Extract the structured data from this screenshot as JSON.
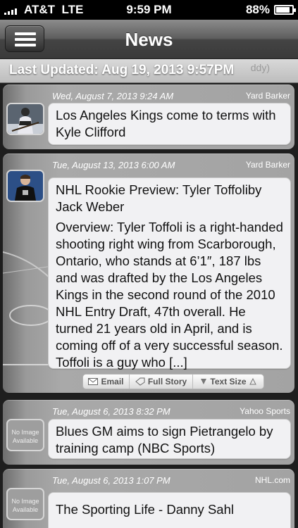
{
  "status_bar": {
    "carrier": "AT&T",
    "network": "LTE",
    "time": "9:59 PM",
    "battery": "88%",
    "battery_level": 0.88
  },
  "nav": {
    "title": "News",
    "menu_icon": "hamburger-icon"
  },
  "updated": {
    "label": "Last Updated: Aug 19, 2013 9:57PM",
    "ghost_text": "ddy)"
  },
  "articles": [
    {
      "date": "Wed, August 7, 2013 9:24 AM",
      "source": "Yard Barker",
      "title": "Los Angeles Kings come to terms with Kyle Clifford",
      "thumb": "player-photo"
    },
    {
      "date": "Tue, August 13, 2013 6:00 AM",
      "source": "Yard Barker",
      "title": "NHL Rookie Preview: Tyler Toffoliby Jack Weber",
      "summary": "Overview: Tyler Toffoli is a right-handed shooting right wing from Scarborough, Ontario, who stands at 6’1″, 187 lbs and was drafted by the Los Angeles Kings in the second round of the 2010 NHL Entry Draft, 47th overall. He turned 21 years old in April, and is coming off of a very successful season. Toffoli is a guy who [...]",
      "thumb": "player-photo",
      "actions": {
        "email": "Email",
        "full_story": "Full Story",
        "text_size": "Text Size"
      }
    },
    {
      "date": "Tue, August 6, 2013 8:32 PM",
      "source": "Yahoo Sports",
      "title": "Blues GM aims to sign Pietrangelo by training camp (NBC Sports)",
      "thumb_text": "No Image Available"
    },
    {
      "date": "Tue, August 6, 2013 1:07 PM",
      "source": "NHL.com",
      "title": "The Sporting Life - Danny Sahl",
      "thumb_text": "No Image Available"
    }
  ],
  "colors": {
    "nav_top": "#8c8c8c",
    "nav_bottom": "#3a3a3a",
    "card": "#a3a3a3",
    "bubble": "#f1f1f3"
  }
}
